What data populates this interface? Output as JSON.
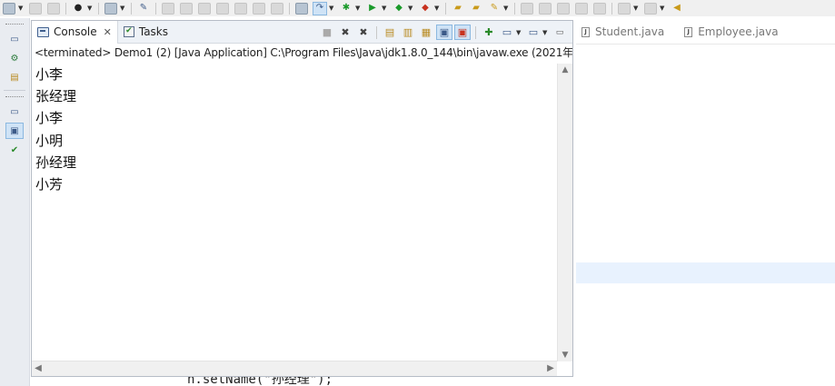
{
  "console_view": {
    "tab_console": "Console",
    "tab_tasks": "Tasks",
    "close_glyph": "✕",
    "status": "<terminated> Demo1 (2) [Java Application] C:\\Program Files\\Java\\jdk1.8.0_144\\bin\\javaw.exe (2021年",
    "output_lines": [
      "小李",
      "张经理",
      "小李",
      "小明",
      "孙经理",
      "小芳"
    ]
  },
  "editor": {
    "tabs": [
      "Student.java",
      "Employee.java"
    ],
    "code_peek": "n.setName(\"孙经理\");"
  },
  "icons": {
    "console": "console-icon",
    "tasks": "tasks-icon",
    "java_file": "java-file-icon"
  },
  "colors": {
    "selection": "#cfe3f6",
    "current_line": "#e8f2fe",
    "tab_bar": "#eef2f7"
  }
}
